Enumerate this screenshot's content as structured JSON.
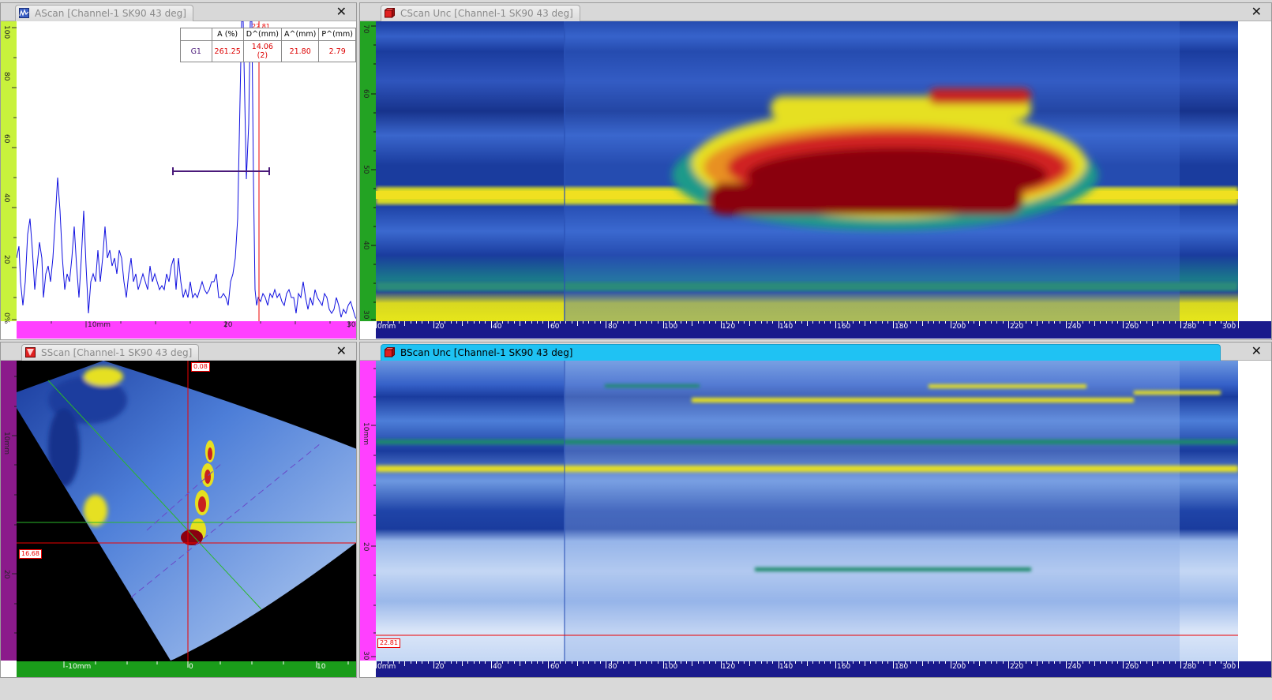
{
  "ascan": {
    "title": "AScan [Channel-1 SK90 43 deg]",
    "icon": "ascan-icon",
    "v_ticks": [
      "100",
      "80",
      "60",
      "40",
      "20",
      "0%"
    ],
    "h_ticks": [
      "10mm",
      "20",
      "30"
    ],
    "cursor_label": "22.81",
    "table": {
      "headers": [
        "",
        "A (%)",
        "D^(mm)",
        "A^(mm)",
        "P^(mm)"
      ],
      "rows": [
        [
          "G1",
          "261.25",
          "14.06 (2)",
          "21.80",
          "2.79"
        ]
      ]
    }
  },
  "cscan": {
    "title": "CScan Unc [Channel-1 SK90 43 deg]",
    "icon": "cscan-icon",
    "v_ticks": [
      "70",
      "60",
      "50",
      "40",
      "30"
    ],
    "h_ticks": [
      "0mm",
      "20",
      "40",
      "60",
      "80",
      "100",
      "120",
      "140",
      "160",
      "180",
      "200",
      "220",
      "240",
      "260",
      "280",
      "300"
    ]
  },
  "sscan": {
    "title": "SScan [Channel-1 SK90 43 deg]",
    "icon": "sscan-icon",
    "v_ticks": [
      "10mm",
      "20"
    ],
    "h_ticks": [
      "-10mm",
      "0",
      "10"
    ],
    "top_cursor": "0.08",
    "left_cursor": "16.68"
  },
  "bscan": {
    "title": "BScan Unc [Channel-1 SK90 43 deg]",
    "icon": "bscan-icon",
    "v_ticks": [
      "10mm",
      "20",
      "30"
    ],
    "h_ticks": [
      "0mm",
      "20",
      "40",
      "60",
      "80",
      "100",
      "120",
      "140",
      "160",
      "180",
      "200",
      "220",
      "240",
      "260",
      "280",
      "300"
    ],
    "cursor_label": "22.81"
  },
  "close_symbol": "✕",
  "colors": {
    "ascan_vscale": "#c8f23c",
    "ascan_hscale": "#ff40ff",
    "cscan_vscale": "#23a323",
    "sscan_vscale": "#8b1a8b",
    "sscan_hscale": "#1a9c1a",
    "bscan_vscale": "#ff40ff",
    "position_scale": "#1a1a8c",
    "active_tab": "#1fc2f3"
  }
}
